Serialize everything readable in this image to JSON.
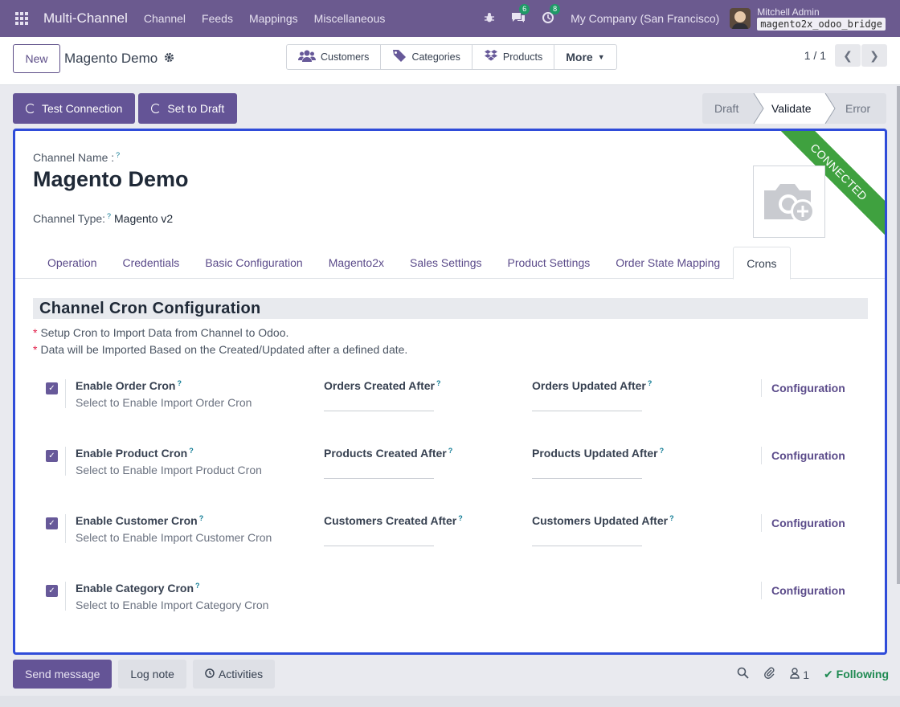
{
  "navbar": {
    "app_name": "Multi-Channel",
    "menus": [
      "Channel",
      "Feeds",
      "Mappings",
      "Miscellaneous"
    ],
    "messages_badge": "6",
    "activities_badge": "8",
    "company": "My Company (San Francisco)",
    "user_name": "Mitchell Admin",
    "database": "magento2x_odoo_bridge"
  },
  "control_panel": {
    "new_label": "New",
    "record_title": "Magento Demo",
    "smart_buttons": [
      "Customers",
      "Categories",
      "Products"
    ],
    "more_label": "More",
    "pager_value": "1 / 1"
  },
  "statusbar": {
    "test_connection_label": "Test Connection",
    "set_to_draft_label": "Set to Draft",
    "stages": [
      "Draft",
      "Validate",
      "Error"
    ],
    "active_stage": "Validate"
  },
  "form": {
    "ribbon": "CONNECTED",
    "channel_name_label": "Channel Name :",
    "channel_name": "Magento Demo",
    "channel_type_label": "Channel Type:",
    "channel_type": "Magento v2",
    "help_mark": "?",
    "tabs": [
      "Operation",
      "Credentials",
      "Basic Configuration",
      "Magento2x",
      "Sales Settings",
      "Product Settings",
      "Order State Mapping",
      "Crons"
    ],
    "active_tab": "Crons",
    "section_title": "Channel Cron Configuration",
    "notes": [
      "Setup Cron to Import Data from Channel to Odoo.",
      "Data will be Imported Based on the Created/Updated after a defined date."
    ],
    "cron_rows": [
      {
        "title": "Enable Order Cron",
        "subtitle": "Select to Enable Import Order Cron",
        "created_label": "Orders Created After",
        "updated_label": "Orders Updated After",
        "config_label": "Configuration",
        "checked": true
      },
      {
        "title": "Enable Product Cron",
        "subtitle": "Select to Enable Import Product Cron",
        "created_label": "Products Created After",
        "updated_label": "Products Updated After",
        "config_label": "Configuration",
        "checked": true
      },
      {
        "title": "Enable Customer Cron",
        "subtitle": "Select to Enable Import Customer Cron",
        "created_label": "Customers Created After",
        "updated_label": "Customers Updated After",
        "config_label": "Configuration",
        "checked": true
      },
      {
        "title": "Enable Category Cron",
        "subtitle": "Select to Enable Import Category Cron",
        "config_label": "Configuration",
        "checked": true
      }
    ]
  },
  "chatter": {
    "send_message_label": "Send message",
    "log_note_label": "Log note",
    "activities_label": "Activities",
    "followers_count": "1",
    "following_label": "Following"
  },
  "colors": {
    "navbar": "#6b5a8f",
    "primary": "#645496",
    "ribbon": "#3fa13f",
    "focus_border": "#2f4cd9"
  }
}
